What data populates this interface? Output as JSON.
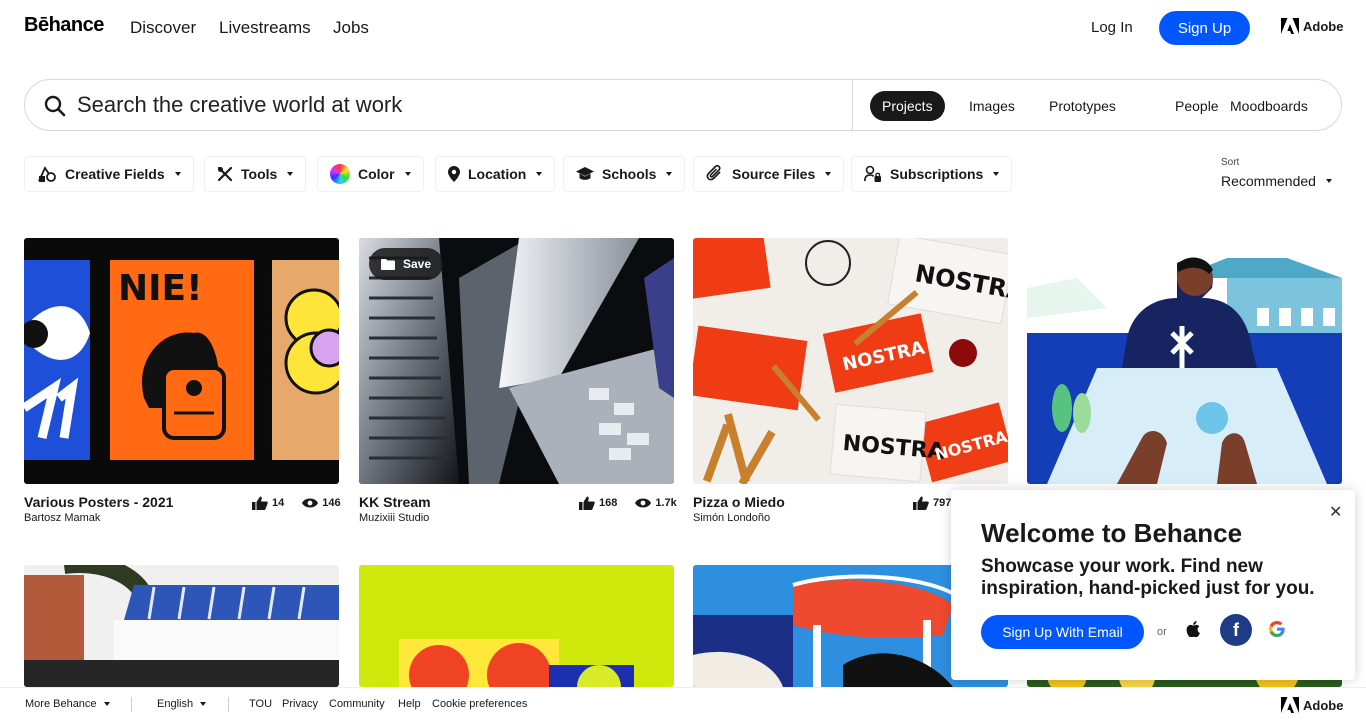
{
  "nav": {
    "logo": "Bēhance",
    "links": [
      "Discover",
      "Livestreams",
      "Jobs"
    ],
    "login": "Log In",
    "signup": "Sign Up",
    "adobe": "Adobe"
  },
  "search": {
    "placeholder": "Search the creative world at work",
    "tabs": [
      "Projects",
      "Images",
      "Prototypes",
      "People",
      "Moodboards"
    ],
    "active_tab": "Projects"
  },
  "filters": [
    "Creative Fields",
    "Tools",
    "Color",
    "Location",
    "Schools",
    "Source Files",
    "Subscriptions"
  ],
  "sort": {
    "label": "Sort",
    "value": "Recommended"
  },
  "projects": [
    {
      "title": "Various Posters - 2021",
      "owner": "Bartosz Mamak",
      "likes": "14",
      "views": "146"
    },
    {
      "title": "KK Stream",
      "owner": "Muzixiii Studio",
      "likes": "168",
      "views": "1.7k",
      "save_label": "Save"
    },
    {
      "title": "Pizza o Miedo",
      "owner": "Simón Londoño",
      "likes": "797"
    }
  ],
  "popup": {
    "title": "Welcome to Behance",
    "body": "Showcase your work. Find new inspiration, hand-picked just for you.",
    "email_button": "Sign Up With Email",
    "or": "or"
  },
  "footer": {
    "more": "More Behance",
    "language": "English",
    "links": [
      "TOU",
      "Privacy",
      "Community",
      "Help",
      "Cookie preferences"
    ],
    "adobe": "Adobe"
  },
  "colors": {
    "brand_blue": "#0057ff",
    "dark": "#191919",
    "facebook": "#1d3c85"
  },
  "icons": [
    "search-icon",
    "creative-fields-icon",
    "tools-icon",
    "color-wheel-icon",
    "location-pin-icon",
    "schools-icon",
    "source-files-icon",
    "subscriptions-icon",
    "like-icon",
    "view-icon",
    "folder-icon",
    "close-icon",
    "apple-icon",
    "facebook-icon",
    "google-icon",
    "adobe-logo-icon"
  ]
}
